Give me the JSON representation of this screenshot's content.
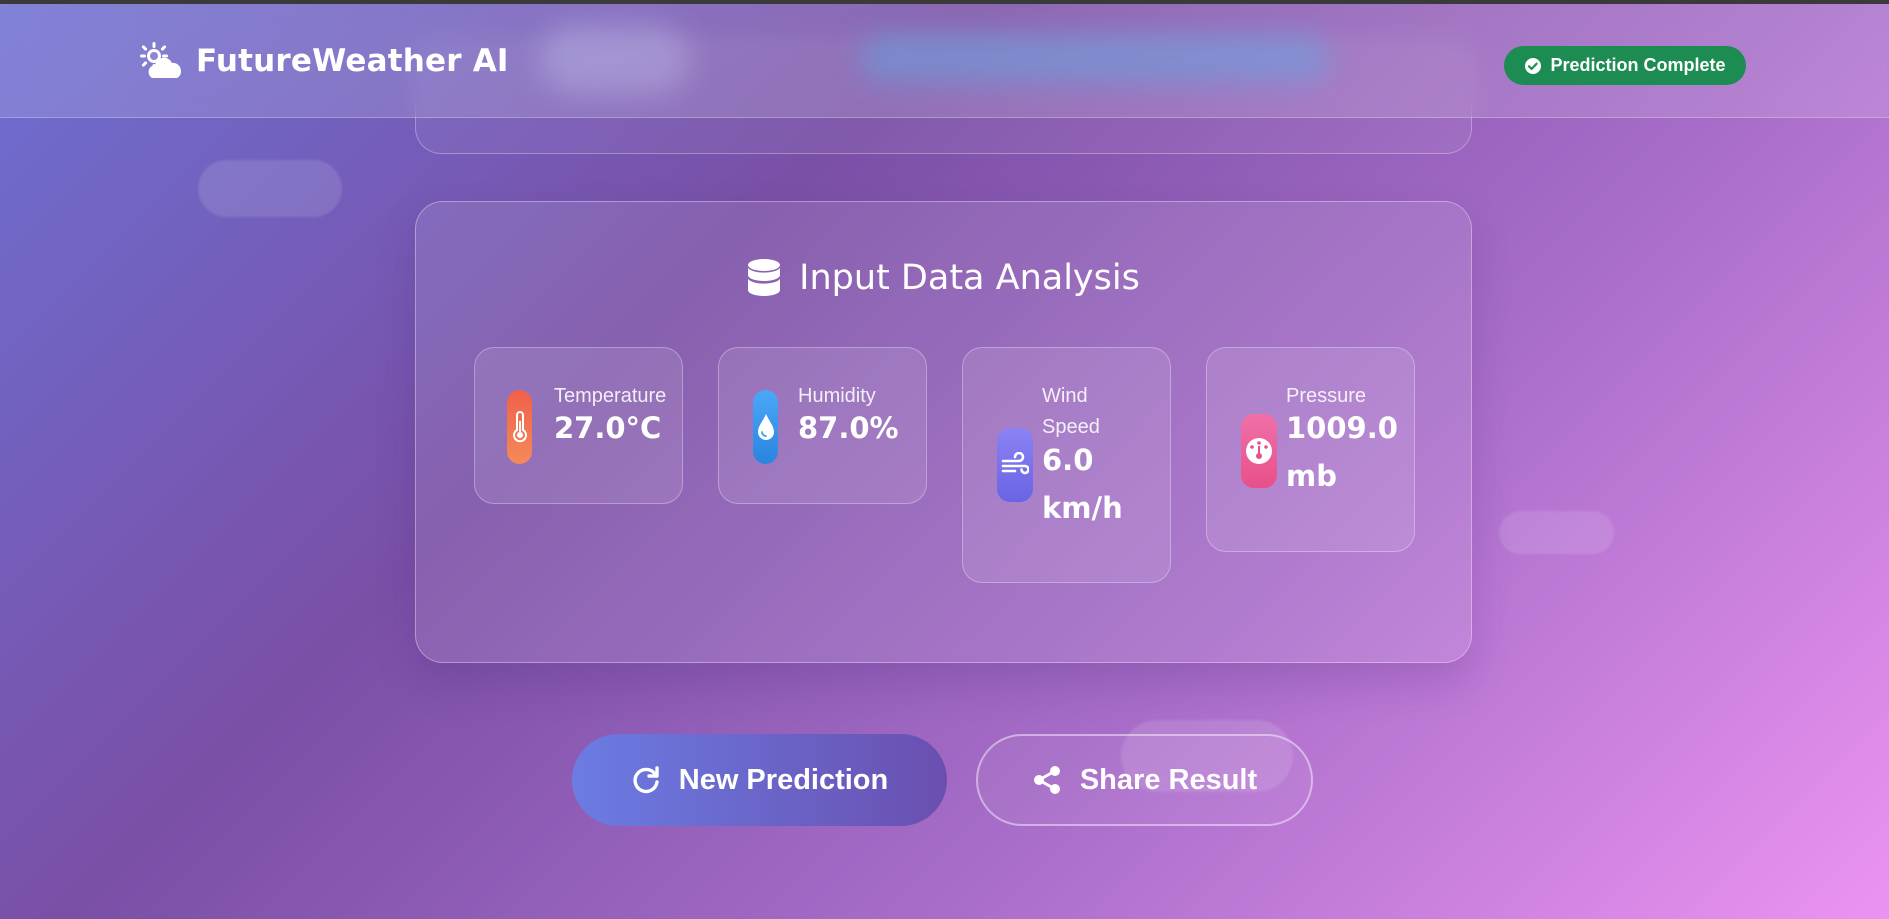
{
  "app": {
    "title": "FutureWeather AI",
    "logo_icon": "sun-cloud-icon"
  },
  "header": {
    "status_badge": "Prediction Complete",
    "status_color": "#1c8c52"
  },
  "input_analysis": {
    "title": "Input Data Analysis",
    "title_icon": "database-icon",
    "metrics": [
      {
        "label": "Temperature",
        "value": "27.0°C",
        "icon": "thermometer-icon",
        "color": "#f0604a"
      },
      {
        "label": "Humidity",
        "value": "87.0%",
        "icon": "droplet-icon",
        "color": "#3a9ef0"
      },
      {
        "label_line1": "Wind",
        "label_line2": "Speed",
        "value_line1": "6.0",
        "value_line2": "km/h",
        "icon": "wind-icon",
        "color": "#7a74f0"
      },
      {
        "label": "Pressure",
        "value_line1": "1009.0",
        "value_line2": "mb",
        "icon": "gauge-icon",
        "color": "#f0609a"
      }
    ]
  },
  "actions": {
    "new_prediction": "New Prediction",
    "share_result": "Share Result"
  }
}
